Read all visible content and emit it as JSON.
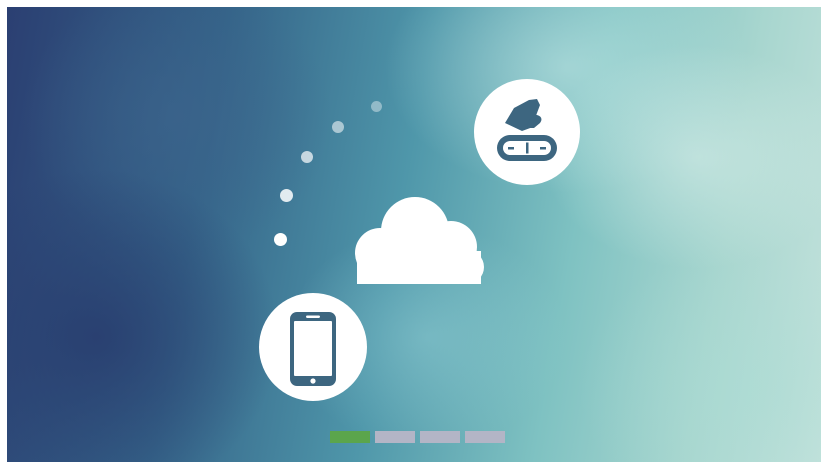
{
  "icons": {
    "robot": "robot-vacuum-icon",
    "cloud": "cloud-icon",
    "phone": "smartphone-icon"
  },
  "colors": {
    "icon_dark": "#3d6680",
    "progress_active": "#5ba54c",
    "progress_inactive": "#b3b5c6"
  },
  "progress": {
    "total_steps": 4,
    "current_step": 1
  }
}
